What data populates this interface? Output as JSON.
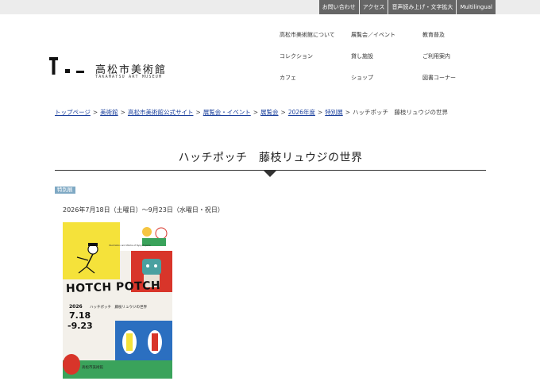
{
  "topbar": {
    "links": [
      "お問い合わせ",
      "アクセス",
      "音声読み上げ・文字拡大",
      "Multilingual"
    ]
  },
  "logo": {
    "jp": "高松市美術館",
    "en": "TAKAMATSU ART MUSEUM"
  },
  "nav": {
    "items": [
      "高松市美術館について",
      "展覧会／イベント",
      "教育普及",
      "コレクション",
      "貸し施設",
      "ご利用案内",
      "カフェ",
      "ショップ",
      "図書コーナー"
    ]
  },
  "breadcrumb": {
    "items": [
      "トップページ",
      "美術館",
      "高松市美術館公式サイト",
      "展覧会・イベント",
      "展覧会",
      "2026年度",
      "特別展"
    ],
    "current": "ハッチポッチ　藤枝リュウジの世界",
    "separator": ">"
  },
  "page": {
    "title": "ハッチポッチ　藤枝リュウジの世界",
    "category": "特別展",
    "date": "2026年7月18日（土曜日）～9月23日（水曜日・祝日）"
  },
  "poster": {
    "title": "HOTCH POTCH",
    "subtitle": "ハッチポッチ　藤枝リュウジの世界",
    "caption": "Illustration and Works of Ryuji Fujieda",
    "year": "2026",
    "date1": "7.18",
    "date2": "-9.23",
    "footer": "高松市美術館"
  },
  "colors": {
    "topbar_bg": "#ececec",
    "topbar_link_bg": "#666666",
    "link": "#1a3f9c",
    "badge": "#7fa9c4",
    "poster_yellow": "#f5e23a",
    "poster_blue": "#2b6fc0",
    "poster_red": "#d8352a",
    "poster_green": "#3aa35b"
  }
}
